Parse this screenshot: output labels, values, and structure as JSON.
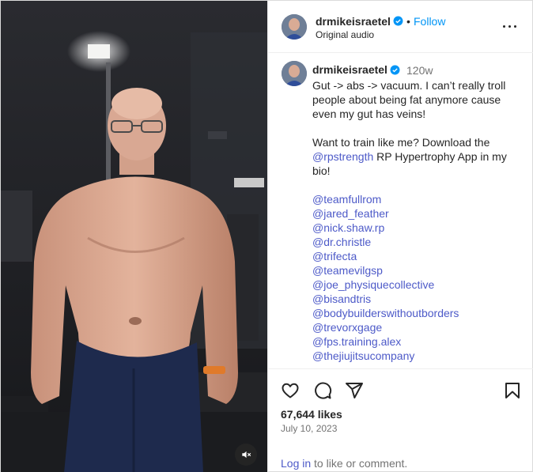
{
  "post": {
    "username": "drmikeisraetel",
    "follow_label": "Follow",
    "separator": "•",
    "audio": "Original audio"
  },
  "caption": {
    "username": "drmikeisraetel",
    "time": "120w",
    "line1": "Gut -> abs -> vacuum. I can’t really troll people about being fat anymore cause even my gut has veins!",
    "line2_before": "Want to train like me? Download the ",
    "line2_mention": "@rpstrength",
    "line2_after": " RP Hypertrophy App in my bio!",
    "mentions": [
      "@teamfullrom",
      "@jared_feather",
      "@nick.shaw.rp",
      "@dr.christle",
      "@trifecta",
      "@teamevilgsp",
      "@joe_physiquecollective",
      "@bisandtris",
      "@bodybuilderswithoutborders",
      "@trevorxgage",
      "@fps.training.alex",
      "@thejiujitsucompany"
    ]
  },
  "stats": {
    "likes": "67,644 likes",
    "date": "July 10, 2023"
  },
  "footer": {
    "login_link": "Log in",
    "login_rest": " to like or comment."
  },
  "icons": {
    "like": "heart-icon",
    "comment": "comment-icon",
    "share": "send-icon",
    "save": "bookmark-icon",
    "more": "more-options-icon",
    "mute": "speaker-muted-icon",
    "verified": "verified-badge-icon"
  },
  "colors": {
    "link": "#4d5ac8",
    "follow": "#0095f6",
    "verified": "#0095f6",
    "muted_text": "#737373"
  }
}
